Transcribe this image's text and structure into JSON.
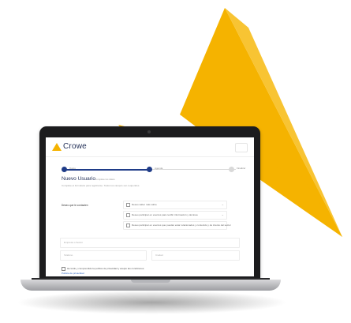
{
  "colors": {
    "brand_yellow": "#F5B300",
    "navy": "#1f2d55",
    "progress_blue": "#1f3c88",
    "link_blue": "#2a63c4"
  },
  "app": {
    "brand": "Crowe",
    "logo_icon": "crowe-mountain-logo"
  },
  "progress": {
    "steps": [
      "Datos",
      "Agenda",
      "Finalizar"
    ],
    "current": 2,
    "fill": 0.5
  },
  "form": {
    "title": "Nuevo Usuario",
    "subtitle": "Complete los datos",
    "description": "Complete el formulario para registrarse. Todos los campos son requeridos.",
    "prompt": "Deseo que le contacten",
    "options": [
      "Deseo saber más sobre",
      "Deseo participar en eventos para recibir información y del área",
      "Deseo participar en eventos que puedan estar relacionados y contenido y de interés del sector"
    ],
    "fields": {
      "business_email": "Empresa o Sector",
      "phone": "Teléfono",
      "city": "Ciudad"
    },
    "consent": "He leído y comprendido la política de privacidad y acepto las condiciones.",
    "policy_link": "Política de privacidad"
  }
}
